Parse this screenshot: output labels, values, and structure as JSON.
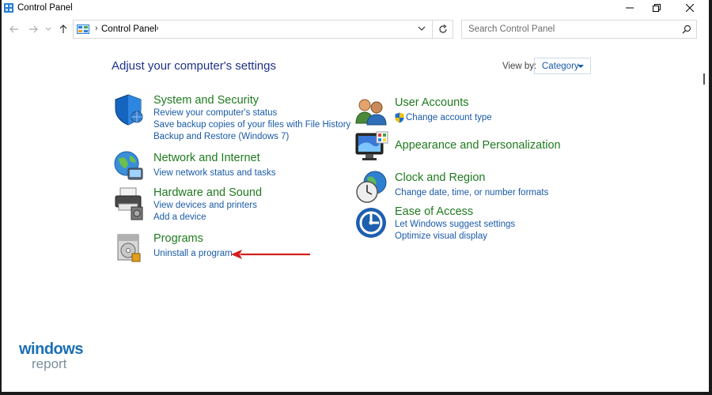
{
  "window": {
    "title": "Control Panel"
  },
  "address": {
    "path": "Control Panel"
  },
  "search": {
    "placeholder": "Search Control Panel"
  },
  "content": {
    "heading": "Adjust your computer's settings",
    "view_by_label": "View by:",
    "view_by_value": "Category"
  },
  "categories": [
    {
      "title": "System and Security",
      "links": [
        "Review your computer's status",
        "Save backup copies of your files with File History",
        "Backup and Restore (Windows 7)"
      ],
      "icon": "system-security-shield-icon"
    },
    {
      "title": "Network and Internet",
      "links": [
        "View network status and tasks"
      ],
      "icon": "network-globe-icon"
    },
    {
      "title": "Hardware and Sound",
      "links": [
        "View devices and printers",
        "Add a device"
      ],
      "icon": "printer-speaker-icon"
    },
    {
      "title": "Programs",
      "links": [
        "Uninstall a program"
      ],
      "icon": "programs-disc-icon"
    },
    {
      "title": "User Accounts",
      "links": [
        "Change account type"
      ],
      "icon": "users-icon"
    },
    {
      "title": "Appearance and Personalization",
      "links": [],
      "icon": "monitor-palette-icon"
    },
    {
      "title": "Clock and Region",
      "links": [
        "Change date, time, or number formats"
      ],
      "icon": "clock-globe-icon"
    },
    {
      "title": "Ease of Access",
      "links": [
        "Let Windows suggest settings",
        "Optimize visual display"
      ],
      "icon": "ease-of-access-icon"
    }
  ],
  "watermark": {
    "line1": "windows",
    "line2": "report"
  },
  "colors": {
    "link": "#1a5aa8",
    "category_title": "#1f7a1f",
    "heading": "#1e3287",
    "annotation_arrow": "#d42020"
  }
}
